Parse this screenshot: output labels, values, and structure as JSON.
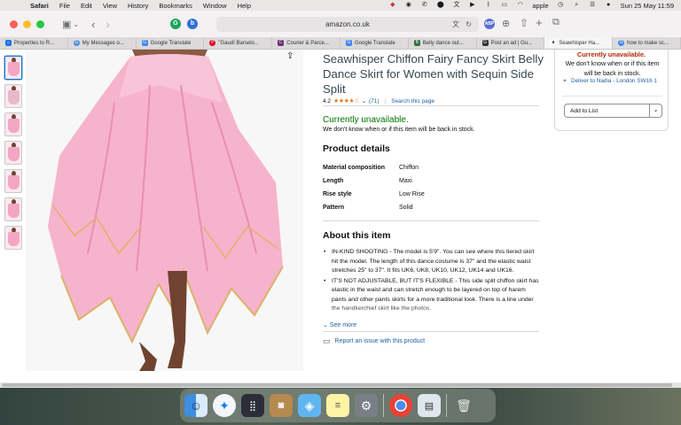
{
  "menubar": {
    "app": "Safari",
    "menus": [
      "File",
      "Edit",
      "View",
      "History",
      "Bookmarks",
      "Window",
      "Help"
    ],
    "user": "apple",
    "datetime": "Sun 25 May  11:59"
  },
  "toolbar": {
    "url": "amazon.co.uk"
  },
  "tabs": [
    {
      "label": "Properties to R...",
      "color": "#1a73e8"
    },
    {
      "label": "My Messages o...",
      "color": "#4a8fe2"
    },
    {
      "label": "Google Translate",
      "color": "#4285f4"
    },
    {
      "label": "\"Gaudí Barselo...",
      "color": "#e60023"
    },
    {
      "label": "Courier & Parce...",
      "color": "#6c2d7a"
    },
    {
      "label": "Google Translate",
      "color": "#4285f4"
    },
    {
      "label": "Belly dance out...",
      "color": "#2f6e3a"
    },
    {
      "label": "Post an ad | Gu...",
      "color": "#333333"
    },
    {
      "label": "Seawhisper Ha...",
      "color": "#222222",
      "active": true
    },
    {
      "label": "how to make sc...",
      "color": "#4285f4"
    }
  ],
  "product": {
    "title": "Seawhisper Chiffon Fairy Fancy Skirt Belly Dance Skirt for Women with Sequin Side Split",
    "rating": "4.2",
    "stars": "★★★★☆",
    "review_count": "(71)",
    "search_link": "Search this page",
    "availability": "Currently unavailable.",
    "availability_sub": "We don't know when or if this item will be back in stock.",
    "details_heading": "Product details",
    "details": [
      {
        "key": "Material composition",
        "value": "Chiffon"
      },
      {
        "key": "Length",
        "value": "Maxi"
      },
      {
        "key": "Rise style",
        "value": "Low Rise"
      },
      {
        "key": "Pattern",
        "value": "Solid"
      }
    ],
    "about_heading": "About this item",
    "bullets": [
      "IN-KIND SHOOTING - The model is 5'9\". You can see where this tiered skirt hit the model. The length of this dance costume is 37\" and the elastic waist stretches 25\" to 37\". It fits UK6, UK8, UK10, UK12, UK14 and UK16.",
      "IT'S NOT ADJUSTABLE, BUT IT'S FLEXIBLE - This side split chiffon skirt has elastic in the waist and can stretch enough to be layered on top of harem pants and other pants skirts for a more traditional look. There is a line under the handkerchief skirt like the photos."
    ],
    "see_more": "See more",
    "report": "Report an issue with this product"
  },
  "buybox": {
    "unavailable": "Currently unavailable.",
    "sub": "We don't know when or if this item will be back in stock.",
    "deliver": "Deliver to Nadia - London SW16 1",
    "add_to_list": "Add to List"
  }
}
